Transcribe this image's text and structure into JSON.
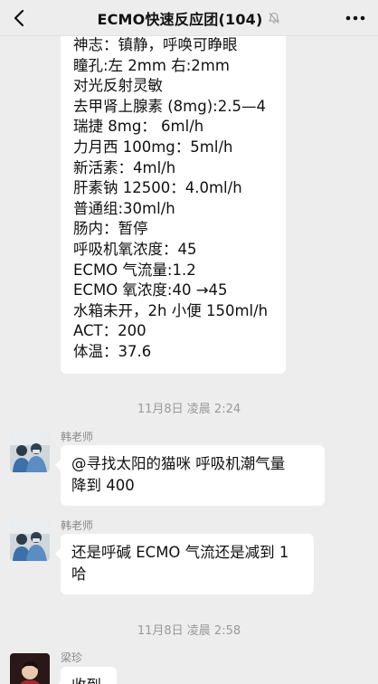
{
  "header": {
    "title": "ECMO快速反应团(104)",
    "back_icon": "chevron-left-icon",
    "mute_icon": "bell-muted-icon",
    "more_icon": "more-dots-icon"
  },
  "first_message": {
    "lines": [
      "神志：镇静，呼唤可睁眼",
      "瞳孔:左 2mm 右:2mm",
      "对光反射灵敏",
      "去甲肾上腺素 (8mg):2.5—4",
      "瑞捷 8mg： 6ml/h",
      "力月西 100mg：5ml/h",
      "新活素：4ml/h",
      "肝素钠 12500：4.0ml/h",
      "普通组:30ml/h",
      "肠内：暂停",
      "呼吸机氧浓度：45",
      "ECMO 气流量:1.2",
      "ECMO 氧浓度:40 →45",
      "水箱未开，2h 小便 150ml/h",
      "ACT：200",
      "体温：37.6"
    ]
  },
  "timestamps": {
    "t1": "11月8日 凌晨 2:24",
    "t2": "11月8日 凌晨 2:58"
  },
  "messages": [
    {
      "sender": "韩老师",
      "text_1": "@寻找太阳的猫咪 呼吸机潮气量",
      "text_2": "降到 400"
    },
    {
      "sender": "韩老师",
      "text_1": "还是呼碱 ECMO 气流还是减到 1",
      "text_2": "哈"
    },
    {
      "sender": "梁珍",
      "text_1": "收到"
    }
  ]
}
